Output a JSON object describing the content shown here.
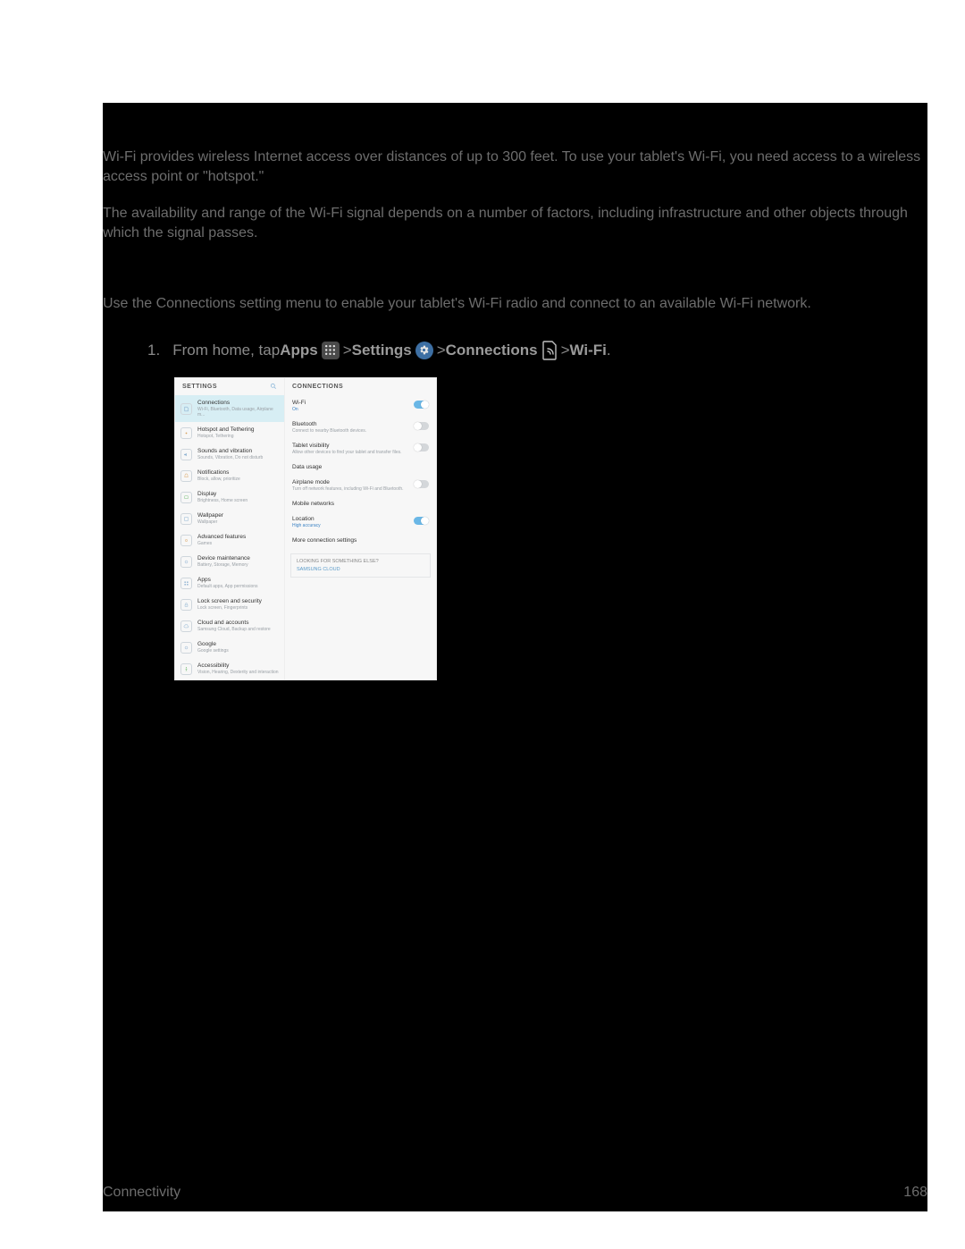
{
  "paragraphs": {
    "p1": "Wi-Fi provides wireless Internet access over distances of up to 300 feet. To use your tablet's Wi-Fi, you need access to a wireless access point or \"hotspot.\"",
    "p2": "The availability and range of the Wi-Fi signal depends on a number of factors, including infrastructure and other objects through which the signal passes.",
    "p3": "Use the Connections setting menu to enable your tablet's Wi-Fi radio and connect to an available Wi-Fi network."
  },
  "step": {
    "num": "1.",
    "t1": "From home, tap ",
    "apps": "Apps",
    "sep": " > ",
    "settings": "Settings",
    "connections": "Connections",
    "wifi": "Wi-Fi",
    "period": "."
  },
  "shot": {
    "settings_title": "SETTINGS",
    "connections_title": "CONNECTIONS",
    "sidebar": [
      {
        "t": "Connections",
        "s": "Wi-Fi, Bluetooth, Data usage, Airplane m..."
      },
      {
        "t": "Hotspot and Tethering",
        "s": "Hotspot, Tethering"
      },
      {
        "t": "Sounds and vibration",
        "s": "Sounds, Vibration, Do not disturb"
      },
      {
        "t": "Notifications",
        "s": "Block, allow, prioritize"
      },
      {
        "t": "Display",
        "s": "Brightness, Home screen"
      },
      {
        "t": "Wallpaper",
        "s": "Wallpaper"
      },
      {
        "t": "Advanced features",
        "s": "Games"
      },
      {
        "t": "Device maintenance",
        "s": "Battery, Storage, Memory"
      },
      {
        "t": "Apps",
        "s": "Default apps, App permissions"
      },
      {
        "t": "Lock screen and security",
        "s": "Lock screen, Fingerprints"
      },
      {
        "t": "Cloud and accounts",
        "s": "Samsung Cloud, Backup and restore"
      },
      {
        "t": "Google",
        "s": "Google settings"
      },
      {
        "t": "Accessibility",
        "s": "Vision, Hearing, Dexterity and interaction"
      }
    ],
    "right": [
      {
        "t": "Wi-Fi",
        "s": "On"
      },
      {
        "t": "Bluetooth",
        "s": "Connect to nearby Bluetooth devices."
      },
      {
        "t": "Tablet visibility",
        "s": "Allow other devices to find your tablet and transfer files."
      },
      {
        "t": "Data usage",
        "s": ""
      },
      {
        "t": "Airplane mode",
        "s": "Turn off network features, including Wi-Fi and Bluetooth."
      },
      {
        "t": "Mobile networks",
        "s": ""
      },
      {
        "t": "Location",
        "s": "High accuracy"
      },
      {
        "t": "More connection settings",
        "s": ""
      }
    ],
    "suggest": {
      "t": "LOOKING FOR SOMETHING ELSE?",
      "s": "SAMSUNG CLOUD"
    }
  },
  "footer": {
    "section": "Connectivity",
    "page": "168"
  }
}
